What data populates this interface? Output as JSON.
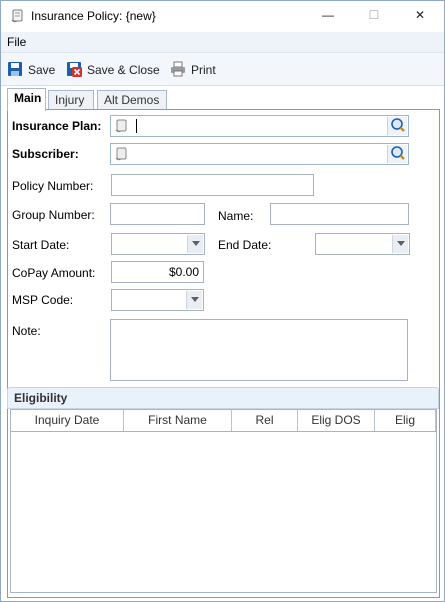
{
  "window": {
    "title": "Insurance Policy: {new}",
    "minimize": "—",
    "maximize": "☐",
    "close": "✕"
  },
  "menu": {
    "file": "File"
  },
  "toolbar": {
    "save": "Save",
    "save_close": "Save & Close",
    "print": "Print"
  },
  "tabs": [
    "Main",
    "Injury",
    "Alt Demos"
  ],
  "form": {
    "insurance_plan_label": "Insurance Plan:",
    "insurance_plan_value": "",
    "subscriber_label": "Subscriber:",
    "subscriber_value": "",
    "policy_number_label": "Policy Number:",
    "policy_number_value": "",
    "group_number_label": "Group Number:",
    "group_number_value": "",
    "name_label": "Name:",
    "name_value": "",
    "start_date_label": "Start Date:",
    "start_date_value": "",
    "end_date_label": "End Date:",
    "end_date_value": "",
    "copay_label": "CoPay Amount:",
    "copay_value": "$0.00",
    "msp_label": "MSP Code:",
    "msp_value": "",
    "note_label": "Note:",
    "note_value": ""
  },
  "eligibility": {
    "title": "Eligibility",
    "columns": [
      "Inquiry Date",
      "First Name",
      "Rel",
      "Elig DOS",
      "Elig"
    ],
    "rows": []
  },
  "colors": {
    "accent": "#1e6ab8",
    "border": "#7f9db9",
    "panel_header": "#e9f1fa"
  }
}
